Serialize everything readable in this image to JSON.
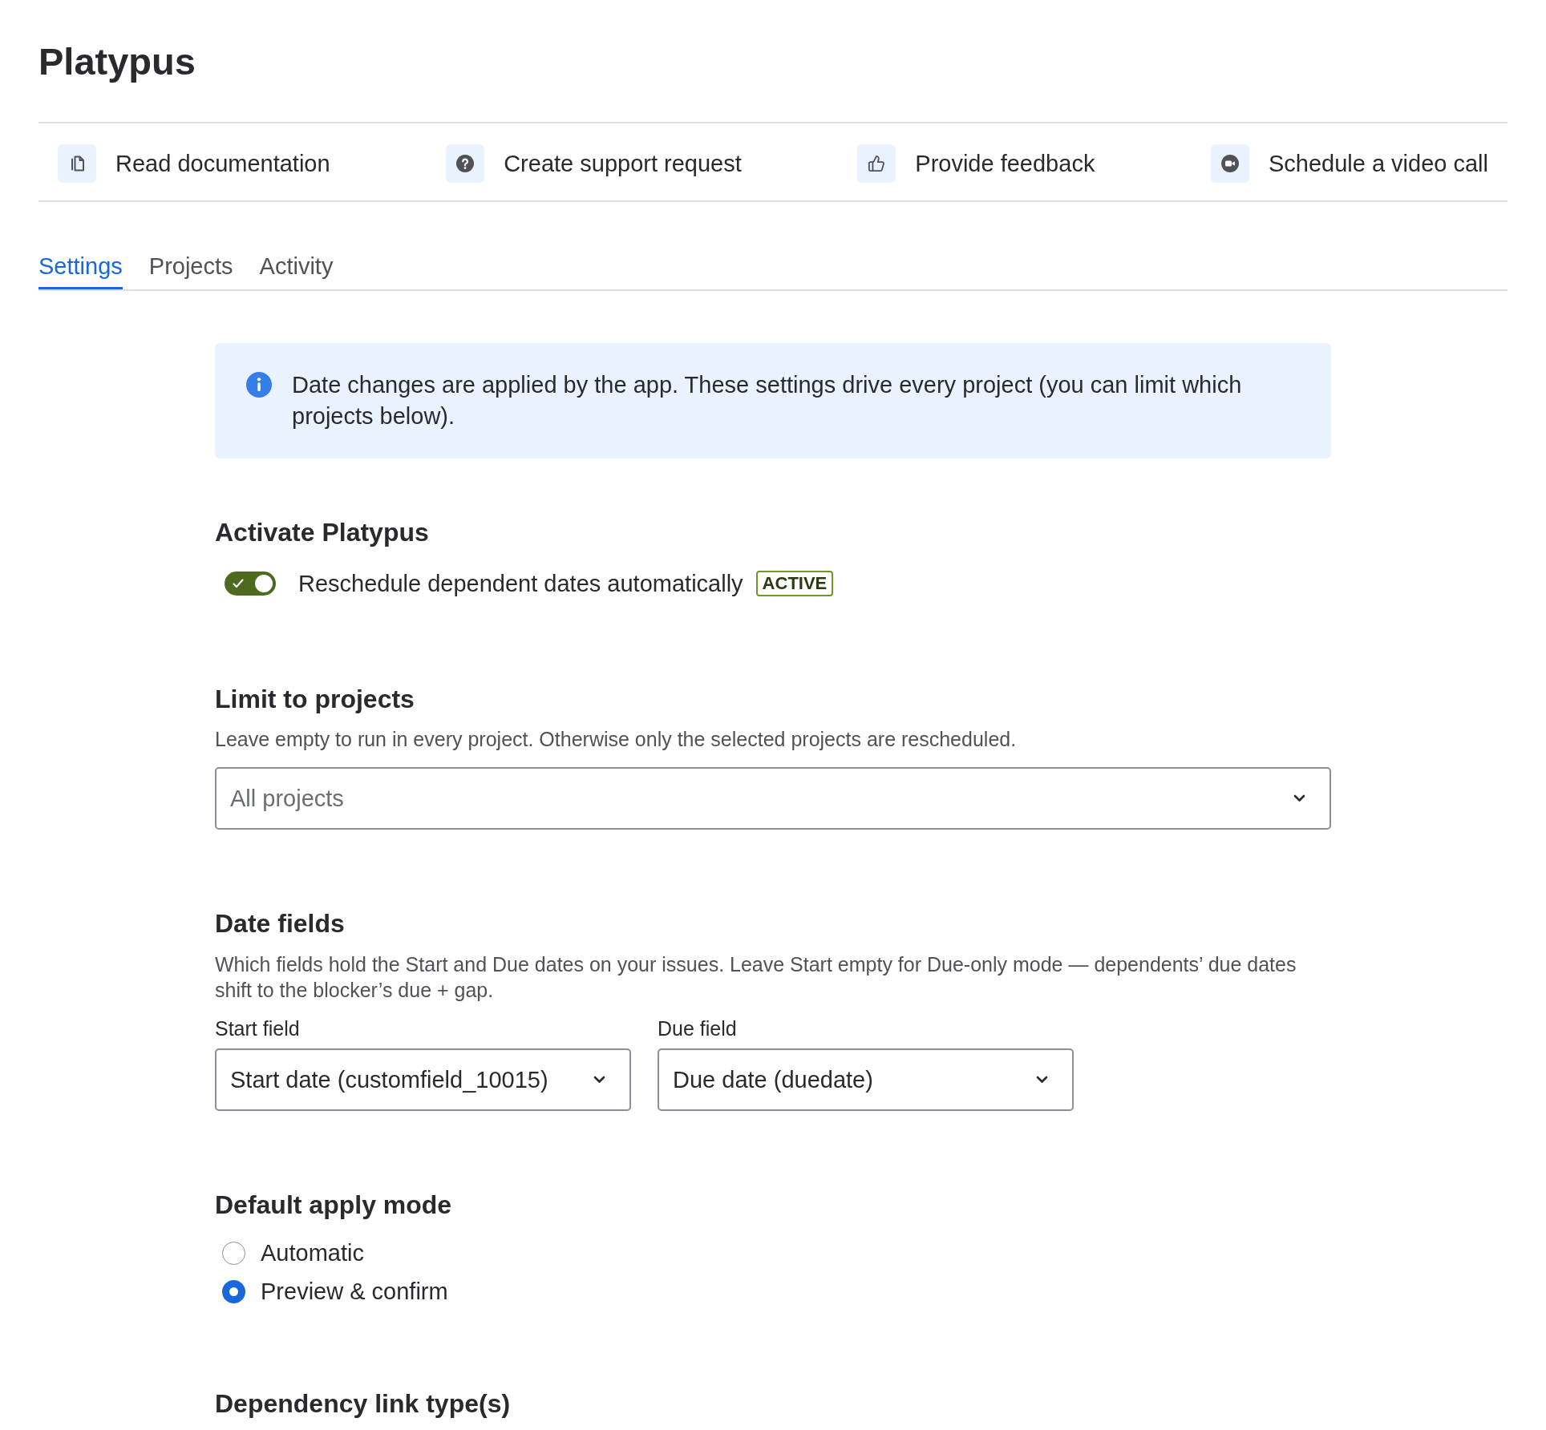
{
  "page": {
    "title": "Platypus"
  },
  "quick_links": [
    {
      "label": "Read documentation"
    },
    {
      "label": "Create support request"
    },
    {
      "label": "Provide feedback"
    },
    {
      "label": "Schedule a video call"
    }
  ],
  "tabs": [
    {
      "label": "Settings",
      "selected": true
    },
    {
      "label": "Projects",
      "selected": false
    },
    {
      "label": "Activity",
      "selected": false
    }
  ],
  "info_banner": {
    "text": "Date changes are applied by the app. These settings drive every project (you can limit which projects below)."
  },
  "activate": {
    "heading": "Activate Platypus",
    "toggle": {
      "label": "Reschedule dependent dates automatically",
      "on": true
    },
    "badge": "ACTIVE"
  },
  "limit_projects": {
    "heading": "Limit to projects",
    "description": "Leave empty to run in every project. Otherwise only the selected projects are rescheduled.",
    "select": {
      "placeholder": "All projects"
    }
  },
  "date_fields": {
    "heading": "Date fields",
    "description": "Which fields hold the Start and Due dates on your issues. Leave Start empty for Due-only mode — dependents’ due dates shift to the blocker’s due + gap.",
    "fields": [
      {
        "label": "Start field",
        "value": "Start date (customfield_10015)"
      },
      {
        "label": "Due field",
        "value": "Due date (duedate)"
      }
    ]
  },
  "apply_mode": {
    "heading": "Default apply mode",
    "options": [
      {
        "label": "Automatic",
        "selected": false
      },
      {
        "label": "Preview & confirm",
        "selected": true
      }
    ]
  },
  "dependency_link_types": {
    "heading": "Dependency link type(s)"
  }
}
